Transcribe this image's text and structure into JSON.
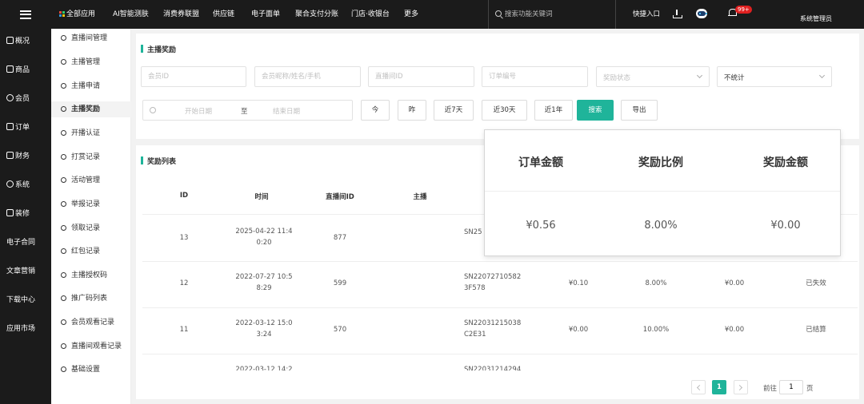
{
  "topbar": {
    "nav": [
      "全部应用",
      "AI智能测肤",
      "消费券联盟",
      "供应链",
      "电子面单",
      "聚合支付分账",
      "门店·收银台",
      "更多"
    ],
    "search_placeholder": "搜索功能关键词",
    "quick_entry": "快捷入口",
    "notification_count": "99+",
    "user_role": "系统管理员",
    "icons": [
      "menu-icon",
      "grid-icon",
      "search-icon",
      "download-icon",
      "robot-icon",
      "bell-icon"
    ]
  },
  "sidebar": {
    "items": [
      "概况",
      "商品",
      "会员",
      "订单",
      "财务",
      "系统",
      "装修",
      "电子合同",
      "文章营销",
      "下载中心",
      "应用市场"
    ]
  },
  "submenu": {
    "items": [
      "直播间管理",
      "主播管理",
      "主播申请",
      "主播奖励",
      "开播认证",
      "打赏记录",
      "活动管理",
      "举报记录",
      "领取记录",
      "红包记录",
      "主播授权码",
      "推广码列表",
      "会员观看记录",
      "直播间观看记录",
      "基础设置"
    ],
    "active": "主播奖励"
  },
  "filter": {
    "title": "主播奖励",
    "member_id_placeholder": "会员ID",
    "member_name_placeholder": "会员昵称/姓名/手机",
    "room_id_placeholder": "直播间ID",
    "order_no_placeholder": "订单编号",
    "reward_status_placeholder": "奖励状态",
    "stat_select_value": "不统计",
    "start_date_placeholder": "开始日期",
    "date_separator": "至",
    "end_date_placeholder": "结束日期",
    "quick_buttons": [
      "今",
      "昨",
      "近7天",
      "近30天",
      "近1年"
    ],
    "search_button": "搜索",
    "export_button": "导出"
  },
  "table": {
    "title": "奖励列表",
    "columns": [
      "ID",
      "时间",
      "直播间ID",
      "主播"
    ],
    "rows": [
      {
        "id": "13",
        "time_line1": "2025-04-22 11:4",
        "time_line2": "0:20",
        "room": "877",
        "order_line1": "SN25",
        "order_line2": "",
        "amount": "",
        "ratio": "",
        "reward": "",
        "status": ""
      },
      {
        "id": "12",
        "time_line1": "2022-07-27 10:5",
        "time_line2": "8:29",
        "room": "599",
        "order_line1": "SN22072710582",
        "order_line2": "3F578",
        "amount": "¥0.10",
        "ratio": "8.00%",
        "reward": "¥0.00",
        "status": "已失效"
      },
      {
        "id": "11",
        "time_line1": "2022-03-12 15:0",
        "time_line2": "3:24",
        "room": "570",
        "order_line1": "SN22031215038",
        "order_line2": "C2E31",
        "amount": "¥0.00",
        "ratio": "10.00%",
        "reward": "¥0.00",
        "status": "已结算"
      },
      {
        "id": "",
        "time_line1": "2022-03-12 14:2",
        "time_line2": "",
        "room": "",
        "order_line1": "SN22031214294",
        "order_line2": "",
        "amount": "",
        "ratio": "",
        "reward": "",
        "status": ""
      }
    ]
  },
  "stats_popup": {
    "labels": [
      "订单金额",
      "奖励比例",
      "奖励金额"
    ],
    "values": [
      "¥0.56",
      "8.00%",
      "¥0.00"
    ]
  },
  "pagination": {
    "current": "1",
    "goto_label": "前往",
    "goto_value": "1",
    "page_suffix": "页"
  },
  "colors": {
    "primary": "#1fb49a",
    "dark_bar": "#1b1b1b",
    "badge": "#e02020"
  }
}
